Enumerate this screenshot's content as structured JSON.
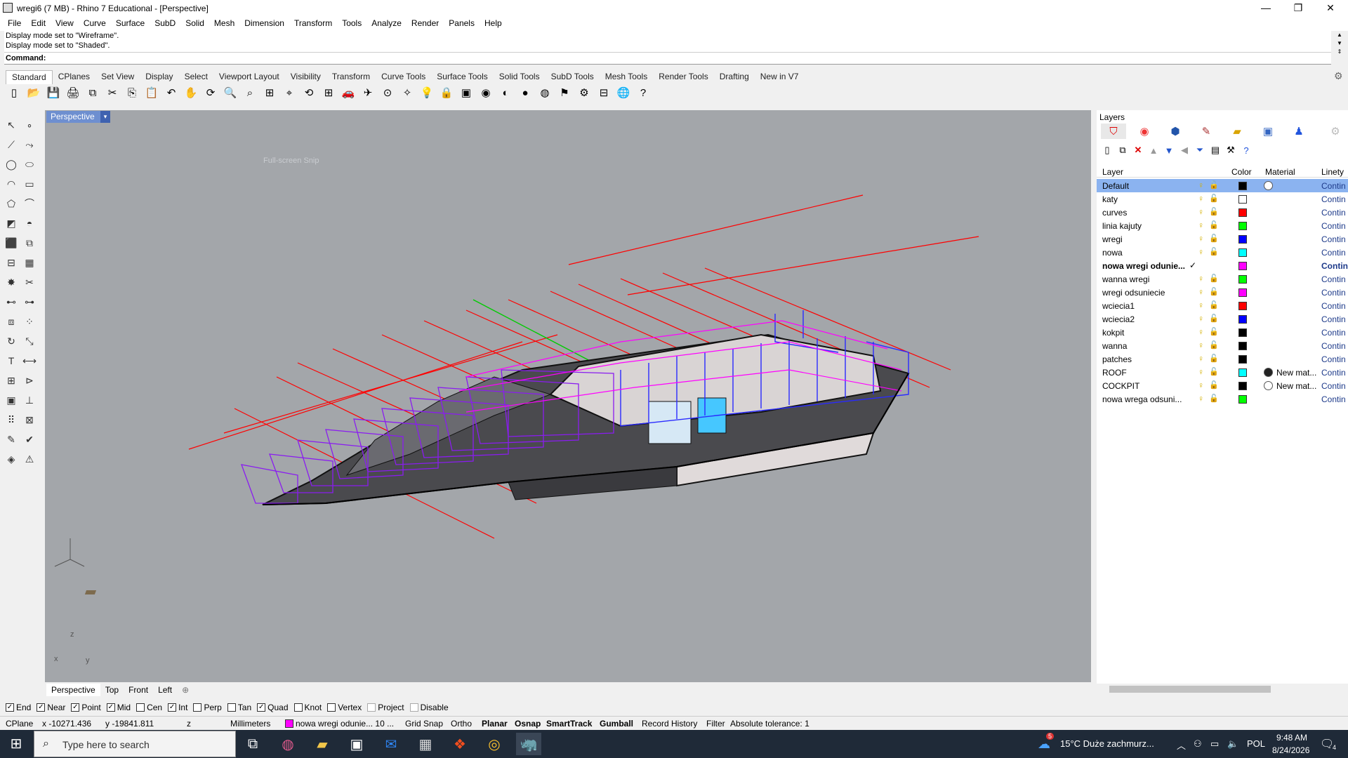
{
  "window": {
    "title": "wregi6 (7 MB) - Rhino 7 Educational - [Perspective]",
    "min": "—",
    "max": "❐",
    "close": "✕"
  },
  "menu": [
    "File",
    "Edit",
    "View",
    "Curve",
    "Surface",
    "SubD",
    "Solid",
    "Mesh",
    "Dimension",
    "Transform",
    "Tools",
    "Analyze",
    "Render",
    "Panels",
    "Help"
  ],
  "command": {
    "history": [
      "Display mode set to \"Wireframe\".",
      "Display mode set to \"Shaded\"."
    ],
    "prompt": "Command:"
  },
  "tabs": [
    "Standard",
    "CPlanes",
    "Set View",
    "Display",
    "Select",
    "Viewport Layout",
    "Visibility",
    "Transform",
    "Curve Tools",
    "Surface Tools",
    "Solid Tools",
    "SubD Tools",
    "Mesh Tools",
    "Render Tools",
    "Drafting",
    "New in V7"
  ],
  "active_tab": "Standard",
  "toolbar_icons": [
    "new-icon",
    "open-icon",
    "save-icon",
    "print-icon",
    "import-icon",
    "cut-icon",
    "copy-icon",
    "paste-icon",
    "undo-icon",
    "pan-icon",
    "rotate-icon",
    "zoom-icon",
    "zoom-window-icon",
    "zoom-extents-icon",
    "zoom-selected-icon",
    "rotate-view-icon",
    "four-views-icon",
    "car-icon",
    "plane-icon",
    "cplane-icon",
    "osnap-icon",
    "bulb-icon",
    "lock-icon",
    "layer-icon",
    "color-wheel-icon",
    "shade-icon",
    "render-sphere-icon",
    "material-sphere-icon",
    "flashlight-icon",
    "gear-icon",
    "dimension-icon",
    "globe-icon",
    "help-icon"
  ],
  "toolbar_glyphs": [
    "▯",
    "📂",
    "💾",
    "🖨",
    "⧉",
    "✂",
    "⎘",
    "📋",
    "↶",
    "✋",
    "⟳",
    "🔍",
    "⌕",
    "⊞",
    "⌖",
    "⟲",
    "⊞",
    "🚗",
    "✈",
    "⊙",
    "✧",
    "💡",
    "🔒",
    "▣",
    "◉",
    "◐",
    "●",
    "◍",
    "⚑",
    "⚙",
    "⊟",
    "🌐",
    "?"
  ],
  "viewport": {
    "label": "Perspective",
    "dropdown": "▾",
    "snip_text": "Full-screen Snip",
    "axis_z": "z",
    "axis_x": "x",
    "axis_y": "y"
  },
  "view_tabs": [
    "Perspective",
    "Top",
    "Front",
    "Left"
  ],
  "view_tab_add": "⊕",
  "layers": {
    "panel_title": "Layers",
    "headers": {
      "layer": "Layer",
      "color": "Color",
      "material": "Material",
      "linetype": "Linety"
    },
    "rows": [
      {
        "name": "Default",
        "color": "#000000",
        "material": "",
        "linetype": "Contin",
        "selected": true,
        "mat": "white"
      },
      {
        "name": "katy",
        "color": "#ffffff",
        "material": "",
        "linetype": "Contin"
      },
      {
        "name": "curves",
        "color": "#ff0000",
        "material": "",
        "linetype": "Contin"
      },
      {
        "name": "linia kajuty",
        "color": "#00ff00",
        "material": "",
        "linetype": "Contin"
      },
      {
        "name": "wregi",
        "color": "#0000ff",
        "material": "",
        "linetype": "Contin"
      },
      {
        "name": "nowa",
        "color": "#00ffff",
        "material": "",
        "linetype": "Contin"
      },
      {
        "name": "nowa wregi odunie...",
        "color": "#ff00ff",
        "material": "",
        "linetype": "Contin",
        "current": true,
        "check": "✓"
      },
      {
        "name": "wanna wregi",
        "color": "#00ff00",
        "material": "",
        "linetype": "Contin"
      },
      {
        "name": "wregi odsuniecie",
        "color": "#ff00ff",
        "material": "",
        "linetype": "Contin"
      },
      {
        "name": "wciecia1",
        "color": "#ff0000",
        "material": "",
        "linetype": "Contin"
      },
      {
        "name": "wciecia2",
        "color": "#0000ff",
        "material": "",
        "linetype": "Contin"
      },
      {
        "name": "kokpit",
        "color": "#000000",
        "material": "",
        "linetype": "Contin"
      },
      {
        "name": "wanna",
        "color": "#000000",
        "material": "",
        "linetype": "Contin"
      },
      {
        "name": "patches",
        "color": "#000000",
        "material": "",
        "linetype": "Contin"
      },
      {
        "name": "ROOF",
        "color": "#00ffff",
        "material": "New mat...",
        "linetype": "Contin",
        "mat": "black"
      },
      {
        "name": "COCKPIT",
        "color": "#000000",
        "material": "New mat...",
        "linetype": "Contin",
        "mat": "white"
      },
      {
        "name": "nowa wrega odsuni...",
        "color": "#00ff00",
        "material": "",
        "linetype": "Contin"
      }
    ]
  },
  "osnaps": [
    {
      "label": "End",
      "checked": true
    },
    {
      "label": "Near",
      "checked": true
    },
    {
      "label": "Point",
      "checked": true
    },
    {
      "label": "Mid",
      "checked": true
    },
    {
      "label": "Cen",
      "checked": false
    },
    {
      "label": "Int",
      "checked": true
    },
    {
      "label": "Perp",
      "checked": false
    },
    {
      "label": "Tan",
      "checked": false
    },
    {
      "label": "Quad",
      "checked": true
    },
    {
      "label": "Knot",
      "checked": false
    },
    {
      "label": "Vertex",
      "checked": false
    },
    {
      "label": "Project",
      "checked": false,
      "disabled": true
    },
    {
      "label": "Disable",
      "checked": false,
      "disabled": true
    }
  ],
  "status": {
    "cplane": "CPlane",
    "x": "x -10271.436",
    "y": "y -19841.811",
    "z": "z",
    "units": "Millimeters",
    "layer": "nowa wregi odunie...",
    "layer_suffix": "10 ...",
    "grid_snap": "Grid Snap",
    "ortho": "Ortho",
    "planar": "Planar",
    "osnap": "Osnap",
    "smarttrack": "SmartTrack",
    "gumball": "Gumball",
    "record_history": "Record History",
    "filter": "Filter",
    "tolerance": "Absolute tolerance: 1"
  },
  "taskbar": {
    "search_placeholder": "Type here to search",
    "weather": "15°C  Duże zachmurz...",
    "lang": "POL",
    "time": "9:48 AM",
    "date": "8/24/2026",
    "notif": "4",
    "badge": "5"
  }
}
